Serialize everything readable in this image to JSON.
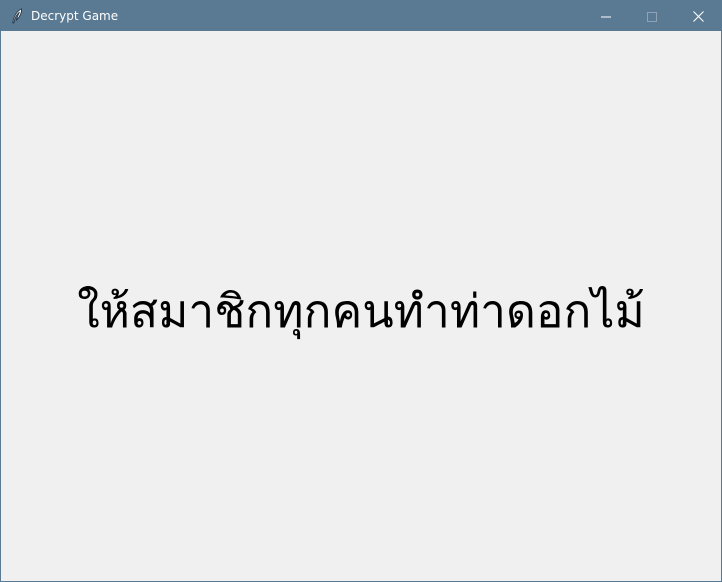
{
  "window": {
    "title": "Decrypt Game",
    "icon": "feather-icon",
    "controls": {
      "minimize": "minimize-icon",
      "maximize": "maximize-icon",
      "close": "close-icon"
    },
    "titlebar_color": "#5a7a94",
    "background_color": "#f0f0f0"
  },
  "content": {
    "message": "ให้สมาชิกทุกคนทำท่าดอกไม้"
  }
}
